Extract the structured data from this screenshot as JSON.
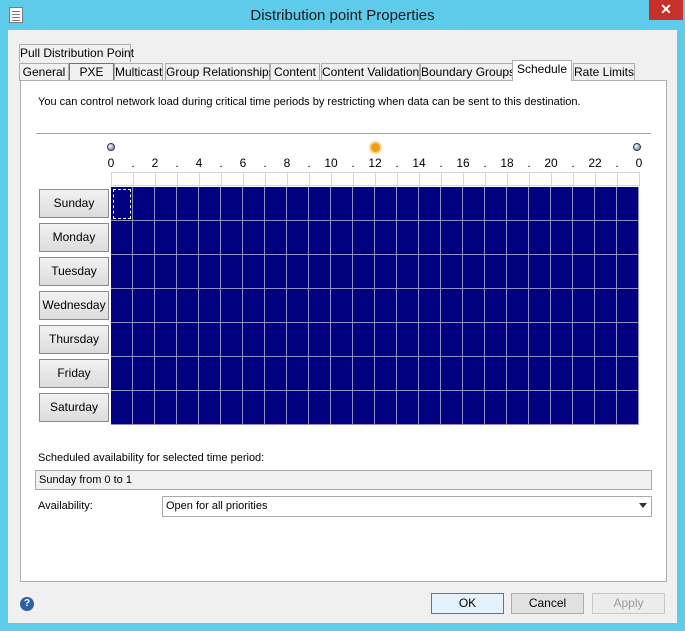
{
  "window": {
    "title": "Distribution point Properties",
    "close_glyph": "✕",
    "title_icon": "properties-sheet-icon"
  },
  "tabs_row_top": [
    {
      "label": "Pull Distribution Point",
      "active": false
    }
  ],
  "tabs_row_bottom": [
    {
      "label": "General",
      "active": false
    },
    {
      "label": "PXE",
      "active": false
    },
    {
      "label": "Multicast",
      "active": false
    },
    {
      "label": "Group Relationships",
      "active": false
    },
    {
      "label": "Content",
      "active": false
    },
    {
      "label": "Content Validation",
      "active": false
    },
    {
      "label": "Boundary Groups",
      "active": false
    },
    {
      "label": "Schedule",
      "active": true
    },
    {
      "label": "Rate Limits",
      "active": false
    }
  ],
  "schedule": {
    "intro": "You can control network load during critical time periods by restricting when data can be sent to this destination.",
    "hour_labels": [
      "0",
      "2",
      "4",
      "6",
      "8",
      "10",
      "12",
      "14",
      "16",
      "18",
      "20",
      "22",
      "0"
    ],
    "hour_separator": ".",
    "icons": {
      "start": "moon-icon",
      "middle": "sun-icon",
      "end": "moon-icon"
    },
    "days": [
      "Sunday",
      "Monday",
      "Tuesday",
      "Wednesday",
      "Thursday",
      "Friday",
      "Saturday"
    ],
    "hours_per_day": 24,
    "cell_color": "#000080",
    "selected_cell": {
      "day": "Sunday",
      "hour": 0
    },
    "selected_label": "Scheduled availability for selected time period:",
    "selected_value": "Sunday from 0 to 1",
    "availability_label": "Availability:",
    "availability_value": "Open for all priorities"
  },
  "buttons": {
    "help_glyph": "?",
    "ok": "OK",
    "cancel": "Cancel",
    "apply": "Apply"
  }
}
